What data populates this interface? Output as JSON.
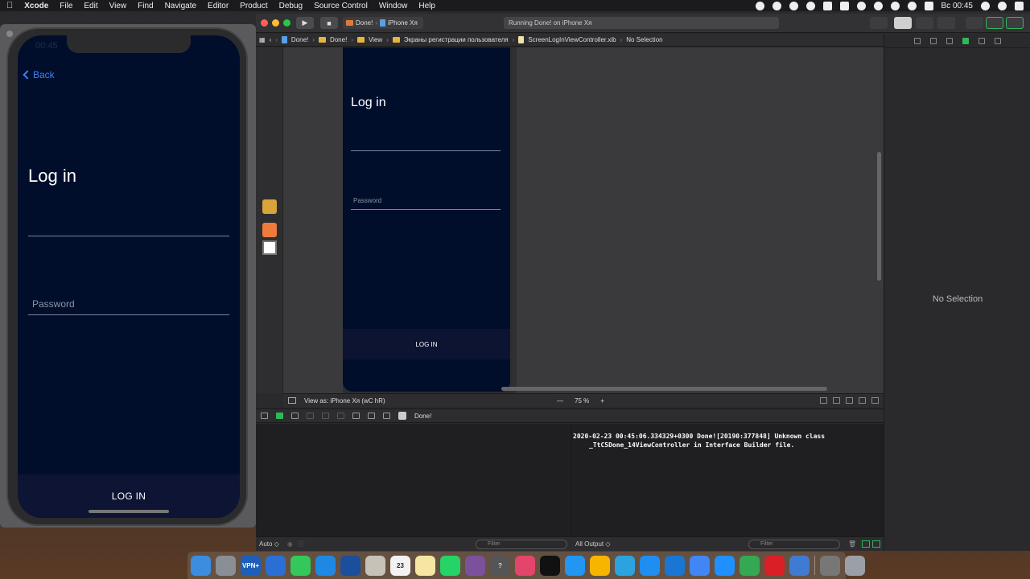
{
  "menubar": {
    "items": [
      "Xcode",
      "File",
      "Edit",
      "View",
      "Find",
      "Navigate",
      "Editor",
      "Product",
      "Debug",
      "Source Control",
      "Window",
      "Help"
    ],
    "clock": "Вс 00:45"
  },
  "simulator": {
    "status_time": "00:45",
    "back_label": "Back",
    "title": "Log in",
    "password_placeholder": "Password",
    "login_button": "LOG IN"
  },
  "toolbar": {
    "scheme_target": "Done!",
    "scheme_device": "iPhone Xя",
    "activity_text": "Running Done! on iPhone Xя"
  },
  "jumpbar": {
    "crumbs": [
      "Done!",
      "Done!",
      "View",
      "Экраны регистрации пользователя",
      "ScreenLogInViewController.xib",
      "No Selection"
    ]
  },
  "canvas": {
    "title": "Log in",
    "password_placeholder": "Password",
    "login_button": "LOG IN"
  },
  "ib_bottom": {
    "view_as": "View as: iPhone Xя (wC hR)",
    "zoom_out": "—",
    "zoom_level": "75 %",
    "zoom_in": "+"
  },
  "debugbar": {
    "process": "Done!"
  },
  "console": {
    "line1": "2020-02-23 00:45:06.334329+0300 Done![20190:377848] Unknown class",
    "line2": "_TtC5Done_14ViewController in Interface Builder file."
  },
  "footer": {
    "auto_label": "Auto ◇",
    "filter_placeholder": "Filter",
    "all_output": "All Output ◇"
  },
  "inspector": {
    "no_selection": "No Selection"
  },
  "dock": {
    "vpn_label": "VPN+"
  }
}
